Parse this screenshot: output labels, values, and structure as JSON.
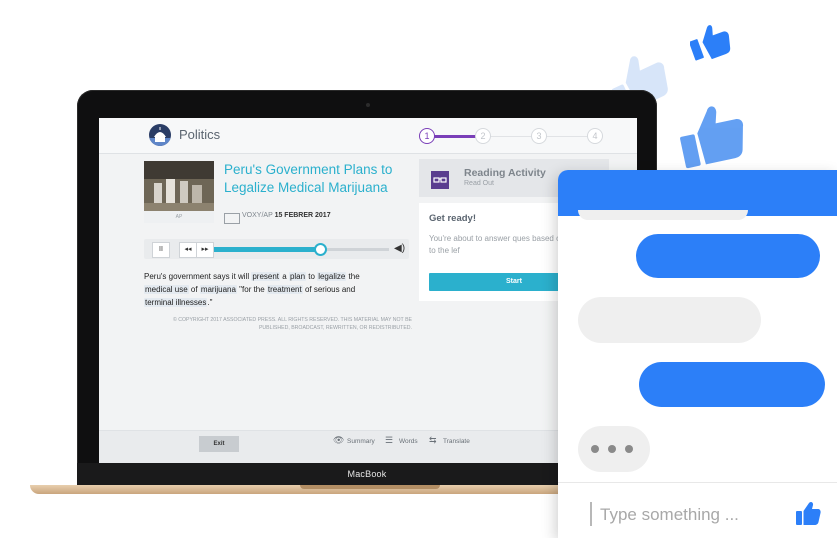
{
  "device": {
    "brand_label": "MacBook"
  },
  "app": {
    "section_title": "Politics",
    "steps": [
      "1",
      "2",
      "3",
      "4"
    ],
    "article": {
      "thumb_caption": "AP",
      "title": "Peru's Government Plans to Legalize Medical Marijuana",
      "source": "VOXY/AP",
      "date": "15 FEBRER 2017",
      "body_parts": [
        {
          "t": "Peru's government says it will ",
          "h": false
        },
        {
          "t": "present",
          "h": true
        },
        {
          "t": " a ",
          "h": false
        },
        {
          "t": "plan",
          "h": true
        },
        {
          "t": " to ",
          "h": false
        },
        {
          "t": "legalize",
          "h": true
        },
        {
          "t": " the ",
          "h": false
        },
        {
          "t": "medical use",
          "h": true
        },
        {
          "t": " of ",
          "h": false
        },
        {
          "t": "marijuana",
          "h": true
        },
        {
          "t": " \"for the ",
          "h": false
        },
        {
          "t": "treatment",
          "h": true
        },
        {
          "t": " of serious and ",
          "h": false
        },
        {
          "t": "terminal illnesses",
          "h": true
        },
        {
          "t": ".\"",
          "h": false
        }
      ],
      "copyright": "© COPYRIGHT 2017 ASSOCIATED PRESS. ALL RIGHTS RESERVED. THIS MATERIAL MAY NOT BE PUBLISHED, BROADCAST, REWRITTEN, OR REDISTRIBUTED."
    },
    "audio": {
      "pause": "II",
      "rewind": "◂◂",
      "forward": "▸▸",
      "volume": "◀)",
      "progress": 0.6
    },
    "activity": {
      "title": "Reading Activity",
      "subtitle": "Read Out",
      "icon": "glasses-icon"
    },
    "ready": {
      "title": "Get ready!",
      "text": "You're about to answer ques based on the story to the lef",
      "start_label": "Start"
    },
    "footer": {
      "exit_label": "Exit",
      "summary_label": "Summary",
      "words_label": "Words",
      "translate_label": "Translate"
    }
  },
  "chat": {
    "input_placeholder": "Type something ...",
    "colors": {
      "accent": "#2c7ff8",
      "bubble_in": "#efefef"
    }
  }
}
